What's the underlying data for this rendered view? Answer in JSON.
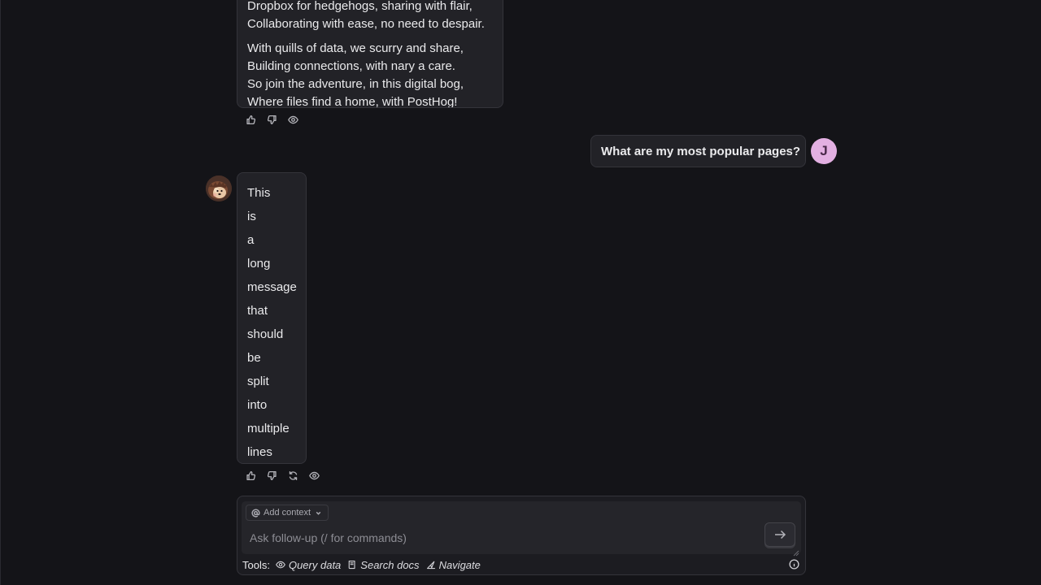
{
  "conversation": {
    "poem_message": {
      "stanza1": [
        "Dropbox for hedgehogs, sharing with flair,",
        "Collaborating with ease, no need to despair."
      ],
      "stanza2": [
        "With quills of data, we scurry and share,",
        "Building connections, with nary a care.",
        "So join the adventure, in this digital bog,",
        "Where files find a home, with PostHog!"
      ]
    },
    "user_message": {
      "text": "What are my most popular pages?",
      "avatar_initial": "J"
    },
    "long_message": {
      "words": [
        "This",
        "is",
        "a",
        "long",
        "message",
        "that",
        "should",
        "be",
        "split",
        "into",
        "multiple",
        "lines"
      ]
    }
  },
  "message_actions": {
    "thumbs_up": "thumbs-up-icon",
    "thumbs_down": "thumbs-down-icon",
    "retry": "retry-icon",
    "view": "eye-icon"
  },
  "composer": {
    "add_context_label": "Add context",
    "placeholder": "Ask follow-up (/ for commands)",
    "value": ""
  },
  "tools": {
    "label": "Tools:",
    "items": [
      {
        "label": "Query data",
        "icon": "eye-icon"
      },
      {
        "label": "Search docs",
        "icon": "book-icon"
      },
      {
        "label": "Navigate",
        "icon": "compass-icon"
      }
    ]
  },
  "colors": {
    "background": "#141418",
    "bubble": "#222227",
    "user_avatar": "#e3b0e2"
  }
}
